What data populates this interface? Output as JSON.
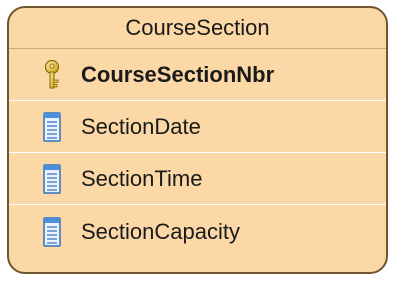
{
  "entity": {
    "name": "CourseSection",
    "colors": {
      "fill": "#fbd8a6",
      "border": "#6f5530",
      "row_separator": "#ffffff",
      "key_icon": "#d9b21e",
      "column_icon": "#4b8fd8"
    },
    "columns": [
      {
        "name": "CourseSectionNbr",
        "icon": "key-icon",
        "primary_key": true
      },
      {
        "name": "SectionDate",
        "icon": "column-icon",
        "primary_key": false
      },
      {
        "name": "SectionTime",
        "icon": "column-icon",
        "primary_key": false
      },
      {
        "name": "SectionCapacity",
        "icon": "column-icon",
        "primary_key": false
      }
    ]
  }
}
